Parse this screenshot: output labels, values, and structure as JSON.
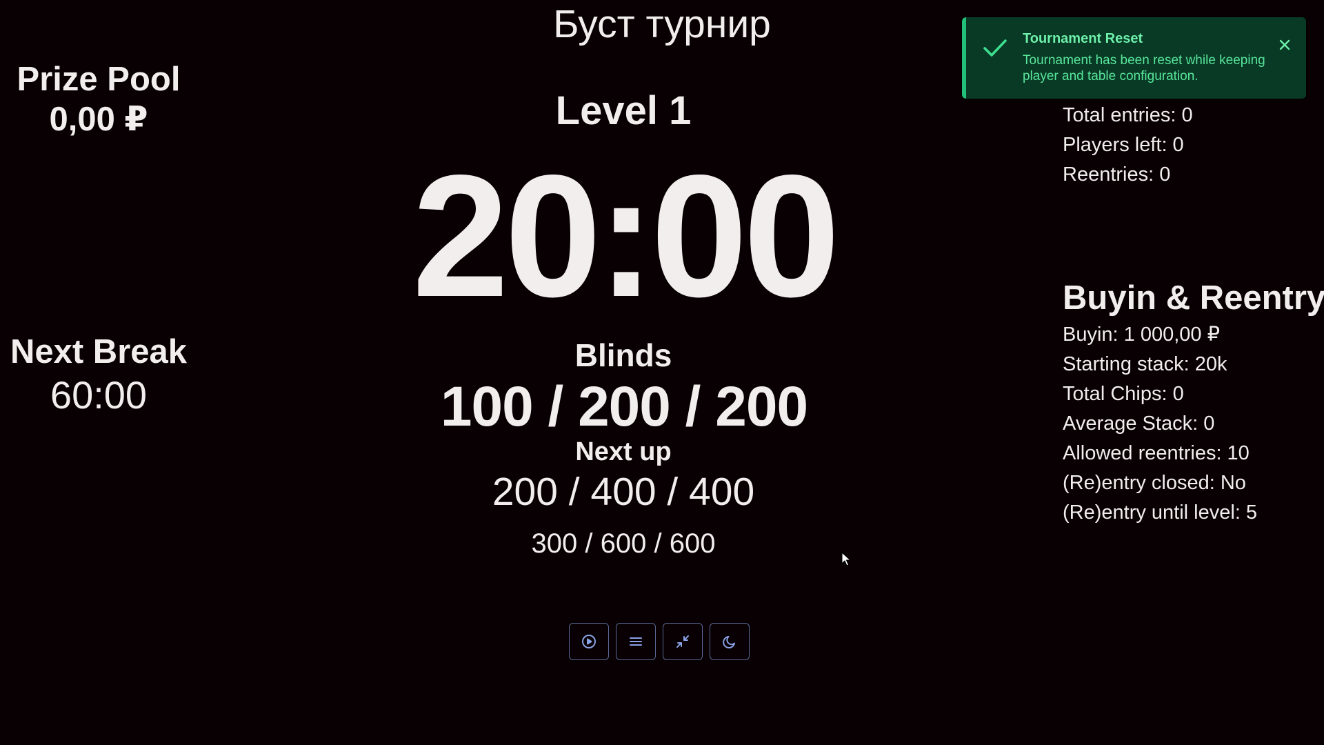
{
  "title": "Буст турнир",
  "prize_pool": {
    "label": "Prize Pool",
    "value": "0,00 ₽"
  },
  "next_break": {
    "label": "Next Break",
    "value": "60:00"
  },
  "level": {
    "label": "Level 1",
    "timer": "20:00"
  },
  "blinds": {
    "label": "Blinds",
    "current": "100 / 200 / 200",
    "next_label": "Next up",
    "next": "200 / 400 / 400",
    "following": "300 / 600 / 600"
  },
  "stats": {
    "total_entries": "Total entries: 0",
    "players_left": "Players left: 0",
    "reentries": "Reentries: 0"
  },
  "buyin": {
    "title": "Buyin & Reentry",
    "items": [
      "Buyin: 1 000,00 ₽",
      "Starting stack: 20k",
      "Total Chips: 0",
      "Average Stack: 0",
      "Allowed reentries: 10",
      "(Re)entry closed: No",
      "(Re)entry until level: 5"
    ]
  },
  "controls": [
    {
      "icon": "play-circle-icon"
    },
    {
      "icon": "menu-icon"
    },
    {
      "icon": "minimize-icon"
    },
    {
      "icon": "moon-icon"
    }
  ],
  "toast": {
    "title": "Tournament Reset",
    "message": "Tournament has been reset while keeping player and table configuration.",
    "icon": "check-icon",
    "close_icon": "close-icon"
  },
  "colors": {
    "background": "#080002",
    "text": "#f2eeee",
    "accent_button": "#8aa2e6",
    "toast_bg": "#083a26",
    "toast_accent": "#22c07a"
  }
}
